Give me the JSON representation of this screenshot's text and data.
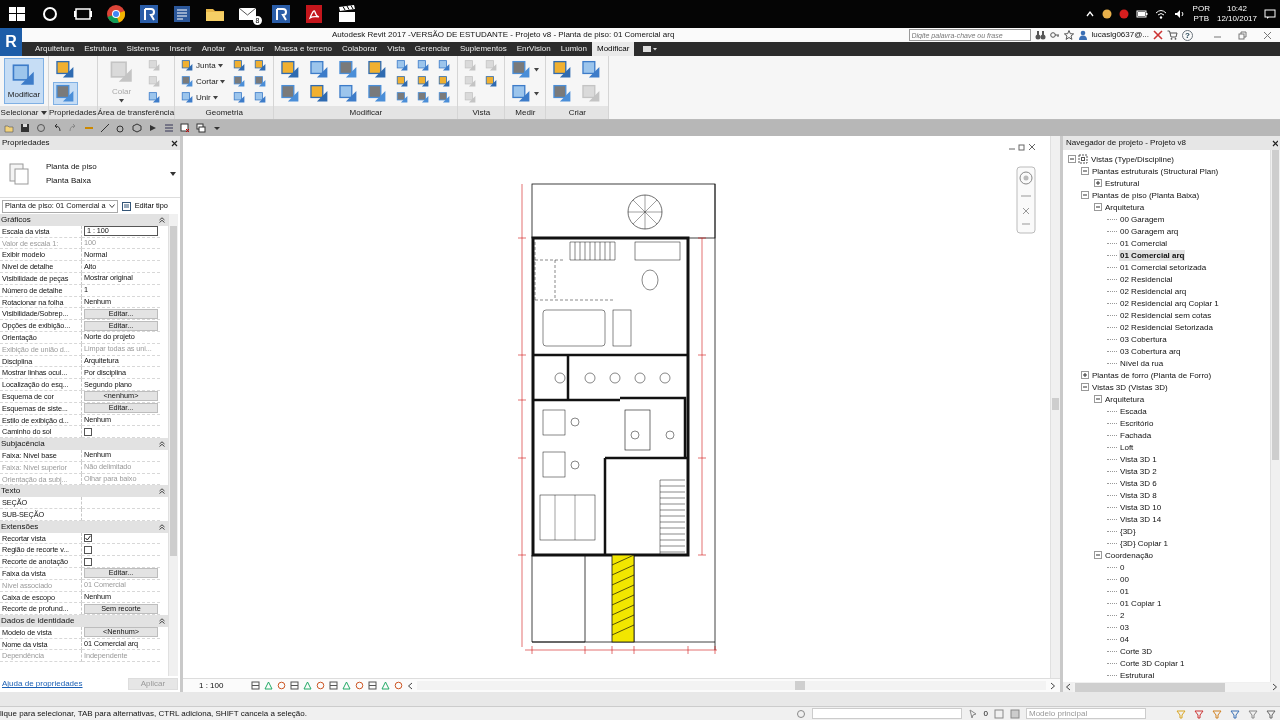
{
  "taskbar": {
    "apps": [
      {
        "kind": "start"
      },
      {
        "kind": "search"
      },
      {
        "kind": "task-view"
      },
      {
        "kind": "browser"
      },
      {
        "kind": "revit"
      },
      {
        "kind": "word"
      },
      {
        "kind": "folder"
      },
      {
        "kind": "mail",
        "badge": "8"
      },
      {
        "kind": "revit"
      },
      {
        "kind": "pdf"
      },
      {
        "kind": "video"
      }
    ],
    "language": "POR",
    "keyboard": "PTB",
    "time": "10:42",
    "date": "12/10/2017"
  },
  "title_bar": {
    "app_button": "R",
    "title": "Autodesk Revit 2017 -VERSÃO DE ESTUDANTE -    Projeto v8 - Planta de piso: 01 Comercial arq",
    "search": {
      "placeholder": "Digite palavra-chave ou frase"
    },
    "user": "lucaslg0637@...",
    "help": "?"
  },
  "ribbon_tabs": [
    {
      "label": "Arquitetura",
      "selected": false
    },
    {
      "label": "Estrutura",
      "selected": false
    },
    {
      "label": "Sistemas",
      "selected": false
    },
    {
      "label": "Inserir",
      "selected": false
    },
    {
      "label": "Anotar",
      "selected": false
    },
    {
      "label": "Analisar",
      "selected": false
    },
    {
      "label": "Massa e terreno",
      "selected": false
    },
    {
      "label": "Colaborar",
      "selected": false
    },
    {
      "label": "Vista",
      "selected": false
    },
    {
      "label": "Gerenciar",
      "selected": false
    },
    {
      "label": "Suplementos",
      "selected": false
    },
    {
      "label": "EnrVision",
      "selected": false
    },
    {
      "label": "Lumion",
      "selected": false
    },
    {
      "label": "Modificar",
      "selected": true
    }
  ],
  "ribbon_panels": [
    {
      "label": "Selecionar",
      "dropdown": true,
      "tools": [
        {
          "kind": "large",
          "label": "Modificar",
          "active": true,
          "disabled": false
        }
      ]
    },
    {
      "label": "Propriedades",
      "tools": [
        {
          "kind": "medium",
          "active": false,
          "disabled": false
        },
        {
          "kind": "medium",
          "active": true,
          "disabled": false
        }
      ]
    },
    {
      "label": "Área de transferência",
      "tools": [
        {
          "kind": "large",
          "label": "Colar",
          "dropdown": true,
          "active": false,
          "disabled": true
        },
        {
          "kind": "small",
          "active": false,
          "disabled": true
        },
        {
          "kind": "small",
          "active": false,
          "disabled": true
        },
        {
          "kind": "small",
          "active": false,
          "disabled": false
        }
      ]
    },
    {
      "label": "Geometria",
      "tools": [
        {
          "kind": "small",
          "label": "Junta",
          "dropdown": true,
          "active": false,
          "disabled": false
        },
        {
          "kind": "small",
          "label": "Cortar",
          "dropdown": true,
          "active": false,
          "disabled": false
        },
        {
          "kind": "small",
          "label": "Unir",
          "dropdown": true,
          "active": false,
          "disabled": false
        },
        {
          "kind": "small",
          "active": false,
          "disabled": false
        },
        {
          "kind": "small",
          "active": false,
          "disabled": false
        },
        {
          "kind": "small",
          "active": false,
          "disabled": false
        },
        {
          "kind": "small",
          "active": false,
          "disabled": false
        },
        {
          "kind": "small",
          "active": false,
          "disabled": false
        },
        {
          "kind": "small",
          "active": false,
          "disabled": false
        }
      ]
    },
    {
      "label": "Modificar",
      "tools": [
        {
          "kind": "medium",
          "active": false,
          "disabled": false
        },
        {
          "kind": "medium",
          "active": false,
          "disabled": false
        },
        {
          "kind": "medium",
          "active": false,
          "disabled": false
        },
        {
          "kind": "medium",
          "active": false,
          "disabled": false
        },
        {
          "kind": "medium",
          "active": false,
          "disabled": false
        },
        {
          "kind": "medium",
          "active": false,
          "disabled": false
        },
        {
          "kind": "medium",
          "active": false,
          "disabled": false
        },
        {
          "kind": "medium",
          "active": false,
          "disabled": false
        },
        {
          "kind": "small",
          "active": false,
          "disabled": false
        },
        {
          "kind": "small",
          "active": false,
          "disabled": false
        },
        {
          "kind": "small",
          "active": false,
          "disabled": false
        },
        {
          "kind": "small",
          "active": false,
          "disabled": false
        },
        {
          "kind": "small",
          "active": false,
          "disabled": false
        },
        {
          "kind": "small",
          "active": false,
          "disabled": false
        },
        {
          "kind": "small",
          "active": false,
          "disabled": false
        },
        {
          "kind": "small",
          "active": false,
          "disabled": false
        },
        {
          "kind": "small",
          "active": false,
          "disabled": false
        }
      ]
    },
    {
      "label": "Vista",
      "tools": [
        {
          "kind": "small",
          "active": false,
          "disabled": true
        },
        {
          "kind": "small",
          "active": false,
          "disabled": true
        },
        {
          "kind": "small",
          "active": false,
          "disabled": true
        },
        {
          "kind": "small",
          "active": false,
          "disabled": true
        },
        {
          "kind": "small",
          "active": false,
          "disabled": false
        }
      ]
    },
    {
      "label": "Medir",
      "tools": [
        {
          "kind": "medium",
          "dropdown": true,
          "active": false,
          "disabled": false
        },
        {
          "kind": "medium",
          "dropdown": true,
          "active": false,
          "disabled": false
        }
      ]
    },
    {
      "label": "Criar",
      "tools": [
        {
          "kind": "medium",
          "active": false,
          "disabled": false
        },
        {
          "kind": "medium",
          "active": false,
          "disabled": false
        },
        {
          "kind": "medium",
          "active": false,
          "disabled": false
        },
        {
          "kind": "medium",
          "active": false,
          "disabled": true
        }
      ]
    }
  ],
  "properties": {
    "title": "Propriedades",
    "type_family": "Planta de piso",
    "type_name": "Planta Baixa",
    "instance_selector": "Planta de piso: 01 Comercial a",
    "edit_type": "Editar tipo",
    "groups": [
      {
        "name": "Gráficos",
        "expanded": true,
        "rows": [
          {
            "label": "Escala da vista",
            "kind": "input",
            "value": "1 : 100",
            "disabled": false
          },
          {
            "label": "Valor de escala    1:",
            "kind": "value",
            "value": "100",
            "disabled": true
          },
          {
            "label": "Exibir modelo",
            "kind": "value",
            "value": "Normal",
            "disabled": false
          },
          {
            "label": "Nível de detalhe",
            "kind": "value",
            "value": "Alto",
            "disabled": false
          },
          {
            "label": "Visibilidade de peças",
            "kind": "value",
            "value": "Mostrar original",
            "disabled": false
          },
          {
            "label": "Número de detalhe",
            "kind": "value",
            "value": "1",
            "disabled": false
          },
          {
            "label": "Rotacionar na folha",
            "kind": "value",
            "value": "Nenhum",
            "disabled": false
          },
          {
            "label": "Visibilidade/Sobrep...",
            "kind": "button",
            "value": "Editar...",
            "disabled": false
          },
          {
            "label": "Opções de exibição...",
            "kind": "button",
            "value": "Editar...",
            "disabled": false
          },
          {
            "label": "Orientação",
            "kind": "value",
            "value": "Norte do projeto",
            "disabled": false
          },
          {
            "label": "Exibição de união d...",
            "kind": "value",
            "value": "Limpar todas as uni...",
            "disabled": true
          },
          {
            "label": "Disciplina",
            "kind": "value",
            "value": "Arquitetura",
            "disabled": false
          },
          {
            "label": "Mostrar linhas ocul...",
            "kind": "value",
            "value": "Por disciplina",
            "disabled": false
          },
          {
            "label": "Localização do esq...",
            "kind": "value",
            "value": "Segundo plano",
            "disabled": false
          },
          {
            "label": "Esquema de cor",
            "kind": "button",
            "value": "<nenhum>",
            "disabled": false
          },
          {
            "label": "Esquemas de siste...",
            "kind": "button",
            "value": "Editar...",
            "disabled": false
          },
          {
            "label": "Estilo de exibição d...",
            "kind": "value",
            "value": "Nenhum",
            "disabled": false
          },
          {
            "label": "Caminho do sol",
            "kind": "checkbox",
            "checked": false,
            "disabled": false
          }
        ]
      },
      {
        "name": "Subjacência",
        "expanded": true,
        "rows": [
          {
            "label": "Faixa: Nível base",
            "kind": "value",
            "value": "Nenhum",
            "disabled": false
          },
          {
            "label": "Faixa: Nível superior",
            "kind": "value",
            "value": "Não delimitado",
            "disabled": true
          },
          {
            "label": "Orientação da subj...",
            "kind": "value",
            "value": "Olhar para baixo",
            "disabled": true
          }
        ]
      },
      {
        "name": "Texto",
        "expanded": true,
        "rows": [
          {
            "label": "SEÇÃO",
            "kind": "text",
            "disabled": false
          },
          {
            "label": "SUB-SEÇÃO",
            "kind": "text",
            "disabled": false
          }
        ]
      },
      {
        "name": "Extensões",
        "expanded": true,
        "rows": [
          {
            "label": "Recortar vista",
            "kind": "checkbox",
            "checked": true,
            "disabled": false
          },
          {
            "label": "Região de recorte v...",
            "kind": "checkbox",
            "checked": false,
            "disabled": false
          },
          {
            "label": "Recorte de anotação",
            "kind": "checkbox",
            "checked": false,
            "disabled": false
          },
          {
            "label": "Faixa da vista",
            "kind": "button",
            "value": "Editar...",
            "disabled": false
          },
          {
            "label": "Nível associado",
            "kind": "value",
            "value": "01 Comercial",
            "disabled": true
          },
          {
            "label": "Caixa de escopo",
            "kind": "value",
            "value": "Nenhum",
            "disabled": false
          },
          {
            "label": "Recorte de profund...",
            "kind": "button",
            "value": "Sem recorte",
            "disabled": false
          }
        ]
      },
      {
        "name": "Dados de identidade",
        "expanded": true,
        "rows": [
          {
            "label": "Modelo de vista",
            "kind": "button",
            "value": "<Nenhum>",
            "disabled": false
          },
          {
            "label": "Nome da vista",
            "kind": "value",
            "value": "01 Comercial arq",
            "disabled": false
          },
          {
            "label": "Dependência",
            "kind": "value",
            "value": "Independente",
            "disabled": true
          }
        ]
      }
    ],
    "help_link": "Ajuda de propriedades",
    "apply": {
      "label": "Aplicar",
      "disabled": true
    }
  },
  "view": {
    "scale": "1 : 100"
  },
  "project_browser": {
    "title": "Navegador de projeto - Projeto v8",
    "tree": [
      {
        "label": "Vistas (Type/Discipline)",
        "expanded": true,
        "selected": false,
        "children": [
          {
            "label": "Plantas estruturais (Structural Plan)",
            "expanded": true,
            "selected": false,
            "children": [
              {
                "label": "Estrutural",
                "expanded": false,
                "selected": false
              }
            ]
          },
          {
            "label": "Plantas de piso (Planta Baixa)",
            "expanded": true,
            "selected": false,
            "children": [
              {
                "label": "Arquitetura",
                "expanded": true,
                "selected": false,
                "children": [
                  {
                    "label": "00 Garagem",
                    "selected": false
                  },
                  {
                    "label": "00 Garagem arq",
                    "selected": false
                  },
                  {
                    "label": "01 Comercial",
                    "selected": false
                  },
                  {
                    "label": "01 Comercial arq",
                    "selected": true
                  },
                  {
                    "label": "01 Comercial setorizada",
                    "selected": false
                  },
                  {
                    "label": "02 Residencial",
                    "selected": false
                  },
                  {
                    "label": "02 Residencial arq",
                    "selected": false
                  },
                  {
                    "label": "02 Residencial arq Copiar 1",
                    "selected": false
                  },
                  {
                    "label": "02 Residencial sem cotas",
                    "selected": false
                  },
                  {
                    "label": "02 Residencial Setorizada",
                    "selected": false
                  },
                  {
                    "label": "03 Cobertura",
                    "selected": false
                  },
                  {
                    "label": "03 Cobertura arq",
                    "selected": false
                  },
                  {
                    "label": "Nível da rua",
                    "selected": false
                  }
                ]
              }
            ]
          },
          {
            "label": "Plantas de forro (Planta de Forro)",
            "expanded": false,
            "selected": false
          },
          {
            "label": "Vistas 3D (Vistas 3D)",
            "expanded": true,
            "selected": false,
            "children": [
              {
                "label": "Arquitetura",
                "expanded": true,
                "selected": false,
                "children": [
                  {
                    "label": "Escada",
                    "selected": false
                  },
                  {
                    "label": "Escritório",
                    "selected": false
                  },
                  {
                    "label": "Fachada",
                    "selected": false
                  },
                  {
                    "label": "Loft",
                    "selected": false
                  },
                  {
                    "label": "Vista 3D 1",
                    "selected": false
                  },
                  {
                    "label": "Vista 3D 2",
                    "selected": false
                  },
                  {
                    "label": "Vista 3D 6",
                    "selected": false
                  },
                  {
                    "label": "Vista 3D 8",
                    "selected": false
                  },
                  {
                    "label": "Vista 3D 10",
                    "selected": false
                  },
                  {
                    "label": "Vista 3D 14",
                    "selected": false
                  },
                  {
                    "label": "{3D}",
                    "selected": false
                  },
                  {
                    "label": "{3D} Copiar 1",
                    "selected": false
                  }
                ]
              },
              {
                "label": "Coordenação",
                "expanded": true,
                "selected": false,
                "children": [
                  {
                    "label": "0",
                    "selected": false
                  },
                  {
                    "label": "00",
                    "selected": false
                  },
                  {
                    "label": "01",
                    "selected": false
                  },
                  {
                    "label": "01 Copiar 1",
                    "selected": false
                  },
                  {
                    "label": "2",
                    "selected": false
                  },
                  {
                    "label": "03",
                    "selected": false
                  },
                  {
                    "label": "04",
                    "selected": false
                  },
                  {
                    "label": "Corte 3D",
                    "selected": false
                  },
                  {
                    "label": "Corte 3D Copiar 1",
                    "selected": false
                  },
                  {
                    "label": "Estrutural",
                    "selected": false
                  }
                ]
              }
            ]
          }
        ]
      }
    ]
  },
  "status_bar": {
    "message": "lique para selecionar, TAB para alternativas, CTRL adiciona, SHIFT cancela a seleção.",
    "selection_count": "0",
    "model": "Modelo principal"
  }
}
